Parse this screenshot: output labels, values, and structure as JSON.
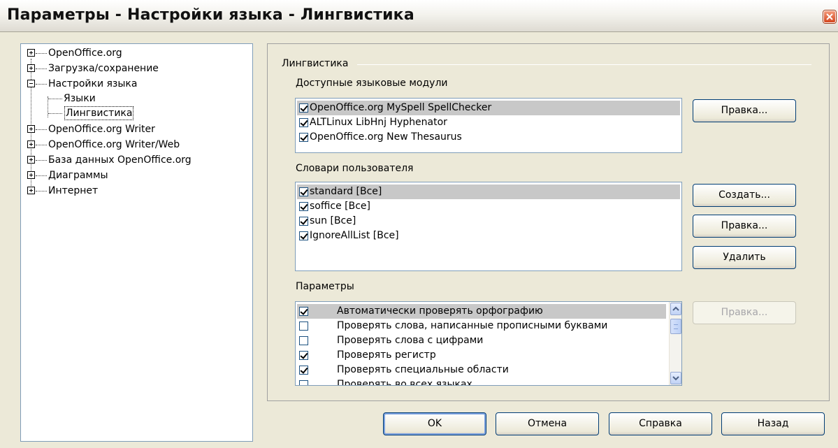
{
  "window": {
    "title": "Параметры - Настройки языка - Лингвистика"
  },
  "tree": {
    "items": [
      {
        "label": "OpenOffice.org",
        "expander": "plus"
      },
      {
        "label": "Загрузка/сохранение",
        "expander": "plus"
      },
      {
        "label": "Настройки языка",
        "expander": "minus"
      },
      {
        "label": "Языки"
      },
      {
        "label": "Лингвистика",
        "selected": true
      },
      {
        "label": "OpenOffice.org Writer",
        "expander": "plus"
      },
      {
        "label": "OpenOffice.org Writer/Web",
        "expander": "plus"
      },
      {
        "label": "База данных OpenOffice.org",
        "expander": "plus"
      },
      {
        "label": "Диаграммы",
        "expander": "plus"
      },
      {
        "label": "Интернет",
        "expander": "plus"
      }
    ]
  },
  "linguistics": {
    "group_label": "Лингвистика",
    "modules": {
      "label": "Доступные языковые модули",
      "items": [
        {
          "label": "OpenOffice.org MySpell SpellChecker",
          "checked": true,
          "selected": true
        },
        {
          "label": "ALTLinux LibHnj Hyphenator",
          "checked": true
        },
        {
          "label": "OpenOffice.org New Thesaurus",
          "checked": true
        }
      ],
      "edit_button": "Правка..."
    },
    "dictionaries": {
      "label": "Словари пользователя",
      "items": [
        {
          "label": "standard [Все]",
          "checked": true,
          "selected": true
        },
        {
          "label": "soffice [Все]",
          "checked": true
        },
        {
          "label": "sun [Все]",
          "checked": true
        },
        {
          "label": "IgnoreAllList [Все]",
          "checked": true
        }
      ],
      "new_button": "Создать...",
      "edit_button": "Правка...",
      "delete_button": "Удалить"
    },
    "options": {
      "label": "Параметры",
      "items": [
        {
          "label": "Автоматически проверять орфографию",
          "checked": true,
          "selected": true
        },
        {
          "label": "Проверять слова, написанные прописными буквами",
          "checked": false
        },
        {
          "label": "Проверять слова с цифрами",
          "checked": false
        },
        {
          "label": "Проверять регистр",
          "checked": true
        },
        {
          "label": "Проверять специальные области",
          "checked": true
        },
        {
          "label": "Проверять во всех языках",
          "checked": false
        }
      ],
      "edit_button": "Правка..."
    }
  },
  "footer": {
    "ok": "OK",
    "cancel": "Отмена",
    "help": "Справка",
    "back": "Назад"
  }
}
